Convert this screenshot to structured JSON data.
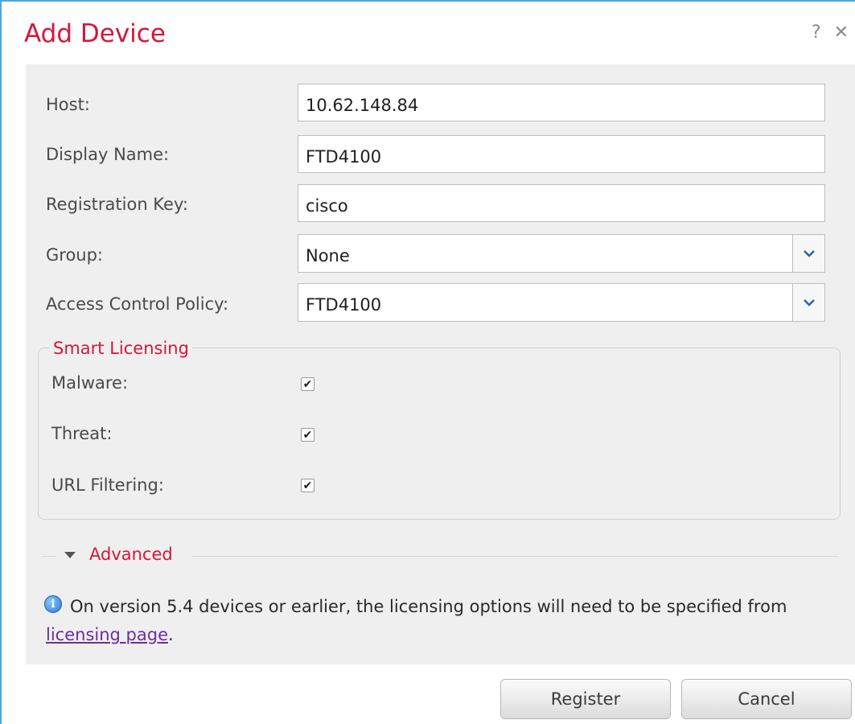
{
  "dialog": {
    "title": "Add Device",
    "help_glyph": "?",
    "close_glyph": "✕"
  },
  "form": {
    "host": {
      "label": "Host:",
      "value": "10.62.148.84"
    },
    "display_name": {
      "label": "Display Name:",
      "value": "FTD4100"
    },
    "registration_key": {
      "label": "Registration Key:",
      "value": "cisco"
    },
    "group": {
      "label": "Group:",
      "value": "None"
    },
    "access_control_policy": {
      "label": "Access Control Policy:",
      "value": "FTD4100"
    }
  },
  "smart_licensing": {
    "legend": "Smart Licensing",
    "items": [
      {
        "label": "Malware:",
        "checked": true
      },
      {
        "label": "Threat:",
        "checked": true
      },
      {
        "label": "URL Filtering:",
        "checked": true
      }
    ]
  },
  "advanced": {
    "label": "Advanced",
    "expanded": false
  },
  "info": {
    "icon": "info-icon",
    "text": "On version 5.4 devices or earlier, the licensing options will need to be specified from ",
    "link_text": "licensing page",
    "suffix": "."
  },
  "buttons": {
    "register": "Register",
    "cancel": "Cancel"
  },
  "colors": {
    "title": "#d6163a",
    "accent_border": "#4aa8e0",
    "link": "#6a2fa0",
    "panel_bg": "#efefef"
  }
}
